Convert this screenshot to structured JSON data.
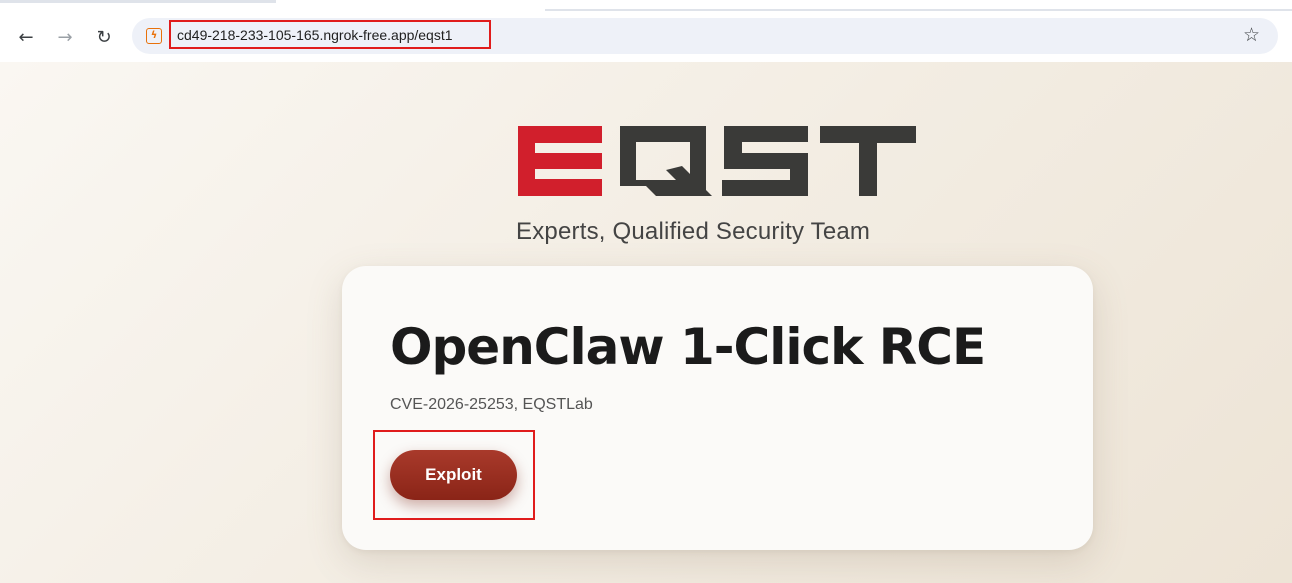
{
  "browser": {
    "back_icon": "←",
    "forward_icon": "→",
    "reload_icon": "↻",
    "site_icon": "ϟ",
    "url": "cd49-218-233-105-165.ngrok-free.app/eqst1",
    "bookmark_icon": "☆"
  },
  "page": {
    "logo_text": "EQST",
    "tagline": "Experts, Qualified Security Team",
    "card": {
      "title": "OpenClaw 1-Click RCE",
      "subtitle": "CVE-2026-25253, EQSTLab",
      "button_label": "Exploit"
    }
  },
  "colors": {
    "brand_red": "#d11f2c",
    "brand_dark": "#3a3a38",
    "button": "#9a2f20",
    "highlight_box": "#e01c1c"
  }
}
